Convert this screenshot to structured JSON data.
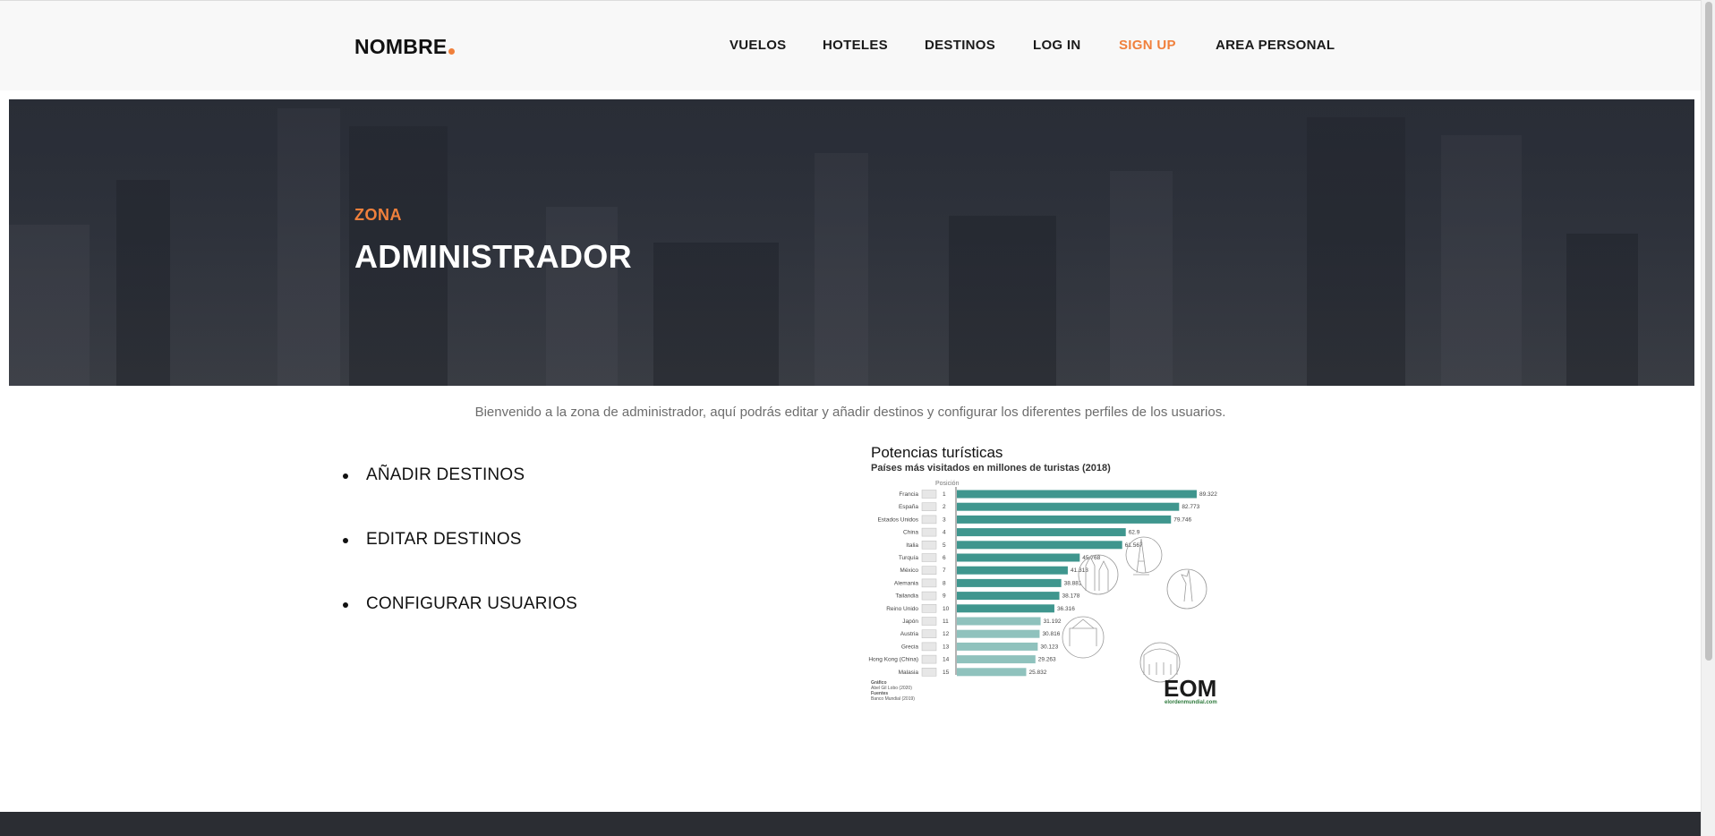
{
  "header": {
    "brand": "NOMBRE",
    "nav": [
      {
        "label": "VUELOS"
      },
      {
        "label": "HOTELES"
      },
      {
        "label": "DESTINOS"
      },
      {
        "label": "LOG IN"
      },
      {
        "label": "SIGN UP",
        "accent": true
      },
      {
        "label": "AREA PERSONAL"
      }
    ],
    "accent_color": "#f0803c"
  },
  "hero": {
    "kicker": "ZONA",
    "title": "ADMINISTRADOR"
  },
  "main": {
    "welcome": "Bienvenido a la zona de administrador, aquí podrás editar y añadir destinos y configurar los diferentes perfiles de los usuarios.",
    "actions": [
      {
        "label": "AÑADIR DESTINOS"
      },
      {
        "label": "EDITAR DESTINOS"
      },
      {
        "label": "CONFIGURAR USUARIOS"
      }
    ]
  },
  "chart_data": {
    "type": "bar",
    "title": "Potencias turísticas",
    "subtitle": "Países más visitados en millones de turistas (2018)",
    "position_header": "Posición",
    "categories": [
      "Francia",
      "España",
      "Estados Unidos",
      "China",
      "Italia",
      "Turquía",
      "México",
      "Alemania",
      "Tailandia",
      "Reino Unido",
      "Japón",
      "Austria",
      "Grecia",
      "Hong Kong (China)",
      "Malasia"
    ],
    "positions": [
      "1",
      "2",
      "3",
      "4",
      "5",
      "6",
      "7",
      "8",
      "9",
      "10",
      "11",
      "12",
      "13",
      "14",
      "15"
    ],
    "values": [
      89.322,
      82.773,
      79.746,
      62.9,
      61.567,
      45.768,
      41.313,
      38.881,
      38.178,
      36.316,
      31.192,
      30.816,
      30.123,
      29.263,
      25.832
    ],
    "value_labels": [
      "89.322",
      "82.773",
      "79.746",
      "62.9",
      "61.567",
      "45.768",
      "41.313",
      "38.881",
      "38.178",
      "36.316",
      "31.192",
      "30.816",
      "30.123",
      "29.263",
      "25.832"
    ],
    "xlim": [
      0,
      100
    ],
    "series_colors": [
      "#3f968e",
      "#8fc2bd"
    ],
    "credits": [
      "Gráfico",
      "Abel Gil Lobo (2020)",
      "Fuentes",
      "Banco Mundial (2019)"
    ],
    "logo": "EOM",
    "logo_url": "elordenmundial.com"
  }
}
